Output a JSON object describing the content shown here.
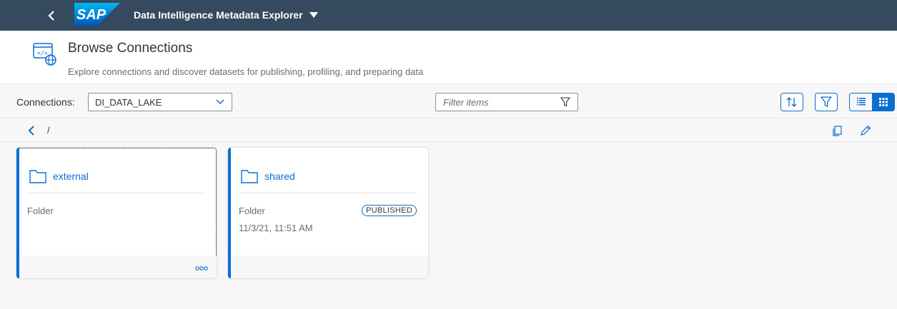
{
  "shell": {
    "logo_text": "SAP",
    "title": "Data Intelligence Metadata Explorer"
  },
  "header": {
    "title": "Browse Connections",
    "subtitle": "Explore connections and discover datasets for publishing, profiling, and preparing data"
  },
  "toolbar": {
    "connections_label": "Connections:",
    "connection_value": "DI_DATA_LAKE",
    "filter_placeholder": "Filter items"
  },
  "breadcrumb": {
    "path": "/"
  },
  "cards": [
    {
      "name": "external",
      "type": "Folder",
      "date": "",
      "badge": ""
    },
    {
      "name": "shared",
      "type": "Folder",
      "date": "11/3/21, 11:51 AM",
      "badge": "PUBLISHED"
    }
  ],
  "colors": {
    "shell_bg": "#354a5f",
    "accent": "#0a6ed1"
  }
}
